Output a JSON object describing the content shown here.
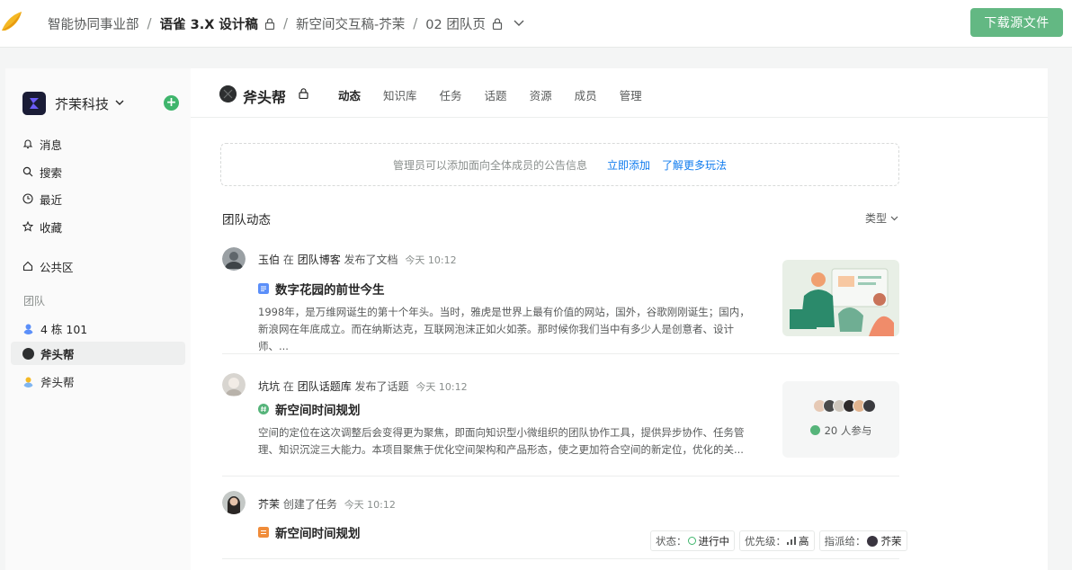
{
  "topbar": {
    "breadcrumbs": [
      "智能协同事业部",
      "语雀 3.X 设计稿",
      "新空间交互稿-芥茉",
      "02 团队页"
    ],
    "download_label": "下载源文件"
  },
  "sidebar": {
    "org_name": "芥茉科技",
    "nav": [
      {
        "label": "消息",
        "icon": "bell-icon"
      },
      {
        "label": "搜索",
        "icon": "search-icon"
      },
      {
        "label": "最近",
        "icon": "clock-icon"
      },
      {
        "label": "收藏",
        "icon": "star-icon"
      }
    ],
    "public_label": "公共区",
    "section_label": "团队",
    "teams": [
      {
        "label": "4 栋 101"
      },
      {
        "label": "斧头帮"
      },
      {
        "label": "斧头帮"
      }
    ]
  },
  "main": {
    "team_name": "斧头帮",
    "tabs": [
      "动态",
      "知识库",
      "任务",
      "话题",
      "资源",
      "成员",
      "管理"
    ],
    "active_tab": "动态",
    "notice": {
      "text": "管理员可以添加面向全体成员的公告信息",
      "link_add": "立即添加",
      "link_more": "了解更多玩法"
    },
    "feed_title": "团队动态",
    "type_filter": "类型",
    "feed": [
      {
        "user": "玉伯",
        "in_word": "在",
        "target": "团队博客",
        "action": "发布了文档",
        "time": "今天 10:12",
        "title": "数字花园的前世今生",
        "excerpt": "1998年，是万维网诞生的第十个年头。当时，雅虎是世界上最有价值的网站，国外，谷歌刚刚诞生；国内，新浪网在年底成立。而在纳斯达克，互联网泡沫正如火如荼。那时候你我们当中有多少人是创意者、设计师、..."
      },
      {
        "user": "坑坑",
        "in_word": "在",
        "target": "团队话题库",
        "action": "发布了话题",
        "time": "今天 10:12",
        "title": "新空间时间规划",
        "excerpt": "空间的定位在这次调整后会变得更为聚焦，即面向知识型小微组织的团队协作工具，提供异步协作、任务管理、知识沉淀三大能力。本项目聚焦于优化空间架构和产品形态，使之更加符合空间的新定位，优化的关...",
        "participants": "20 人参与"
      },
      {
        "user": "芥茉",
        "action": "创建了任务",
        "time": "今天 10:12",
        "title": "新空间时间规划",
        "status_label": "状态：",
        "status_value": "进行中",
        "priority_label": "优先级：",
        "priority_value": "高",
        "assignee_label": "指派给：",
        "assignee_value": "芥茉"
      }
    ]
  },
  "colors": {
    "primary_green": "#63b883",
    "link_blue": "#117cee",
    "doc_blue": "#5b8ff9",
    "topic_green": "#56b47a",
    "task_orange": "#f08c3a"
  }
}
